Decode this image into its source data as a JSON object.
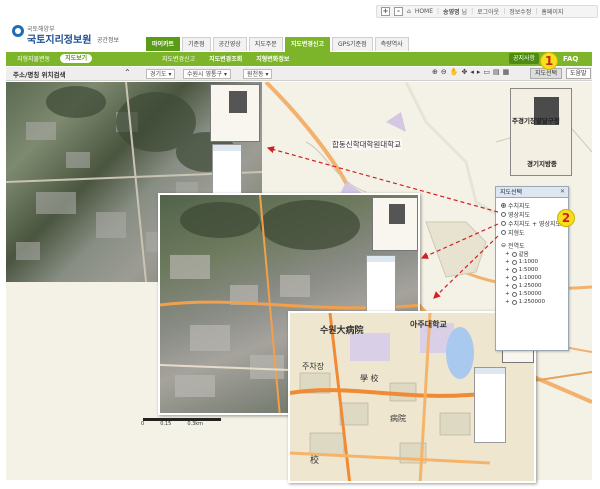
{
  "utility": {
    "zoom_plus": "+",
    "zoom_minus": "-",
    "home": "HOME",
    "user_name": "송영명",
    "user_suffix": "님",
    "logout": "로그아웃",
    "info_edit": "정보수정",
    "homepage": "홈페이지"
  },
  "brand": {
    "ministry": "국토해양부",
    "name": "국토지리정보원",
    "service": "공간정보"
  },
  "tabs": [
    "마이카트",
    "기준점",
    "공간영상",
    "지도주문",
    "지도변경신고",
    "GPS기준점",
    "측량역사"
  ],
  "subnav": {
    "left_label": "지형지물변동",
    "left_pill": "지도보기",
    "items": [
      "지도변경신고",
      "지도변경조회",
      "지형변화정보"
    ],
    "notice": "공지사항",
    "faq": "FAQ"
  },
  "toolbar": {
    "search_title": "주소/명칭 위치검색",
    "select1": "경기도",
    "select2": "수원시 영통구",
    "select3": "원천동",
    "map_select": "지도선택",
    "help": "도움말",
    "icons": [
      "zoom-in-icon",
      "zoom-out-icon",
      "pan-icon",
      "move-icon",
      "prev-icon",
      "next-icon",
      "measure-icon",
      "area-icon",
      "print-icon"
    ]
  },
  "map": {
    "campus_label": "합동신학대학원대학교",
    "overview_label1": "주경기장팔달구청",
    "overview_label2": "경기지방중",
    "scale_labels": [
      "0",
      "0.15",
      "0.3km"
    ],
    "street_labels": [
      "수원大病院",
      "아주대학교",
      "주차장",
      "學 校",
      "病院",
      "校"
    ]
  },
  "layer_panel": {
    "title": "지도선택",
    "map_types": [
      {
        "label": "수치지도",
        "selected": true
      },
      {
        "label": "영상지도",
        "selected": false
      },
      {
        "label": "수치지도 + 영상지도",
        "selected": false
      },
      {
        "label": "지형도",
        "selected": false
      }
    ],
    "scale_title": "전역도",
    "scales": [
      "같음",
      "1:1000",
      "1:5000",
      "1:10000",
      "1:25000",
      "1:50000",
      "1:250000"
    ]
  },
  "callouts": [
    "1",
    "2"
  ],
  "colors": {
    "green_bar": "#7cb42a",
    "brand_blue": "#1b4f93",
    "callout_yellow": "#f7e01b",
    "arrow_red": "#d02020"
  }
}
